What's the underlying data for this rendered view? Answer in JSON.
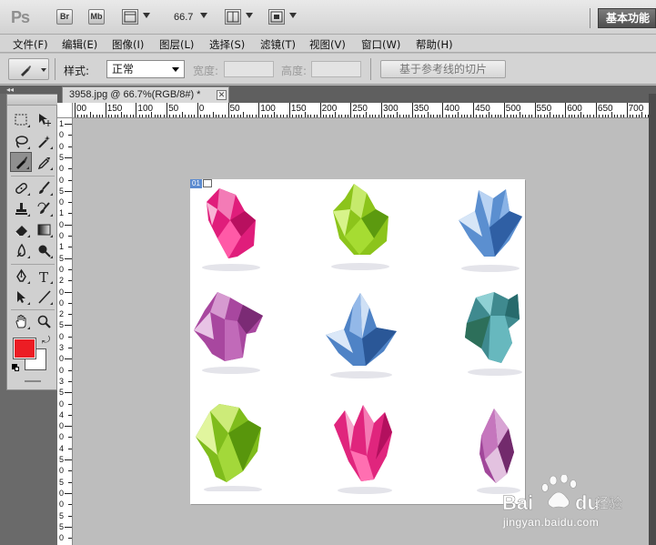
{
  "app": {
    "logo": "Ps",
    "bridge_label": "Br",
    "minibridge_label": "Mb",
    "zoom": "66.7",
    "workspace_label": "基本功能"
  },
  "menu": {
    "items": [
      "文件(F)",
      "编辑(E)",
      "图像(I)",
      "图层(L)",
      "选择(S)",
      "滤镜(T)",
      "视图(V)",
      "窗口(W)",
      "帮助(H)"
    ]
  },
  "options": {
    "style_label": "样式:",
    "style_value": "正常",
    "width_label": "宽度:",
    "height_label": "高度:",
    "slice_button": "基于参考线的切片"
  },
  "document": {
    "tab_title": "3958.jpg @ 66.7%(RGB/8#) *",
    "close_symbol": "✕",
    "slice_number": "01"
  },
  "rulers": {
    "horizontal": [
      "00",
      "150",
      "100",
      "50",
      "0",
      "50",
      "100",
      "150",
      "200",
      "250",
      "300",
      "350",
      "400",
      "450",
      "500",
      "550",
      "600",
      "650",
      "700"
    ],
    "vertical": [
      "1",
      "0",
      "0",
      "5",
      "0",
      "0",
      "5",
      "0",
      "1",
      "0",
      "0",
      "1",
      "5",
      "0",
      "2",
      "0",
      "0",
      "2",
      "5",
      "0",
      "3",
      "0",
      "0",
      "3",
      "5",
      "0",
      "4",
      "0",
      "0",
      "4",
      "5",
      "0",
      "5",
      "0",
      "0",
      "5",
      "5",
      "0"
    ]
  },
  "colors": {
    "foreground": "#ec1d24",
    "background": "#ffffff",
    "canvas_gray": "#bdbdbd"
  },
  "tools": [
    "marquee-icon",
    "move-icon",
    "lasso-icon",
    "magic-wand-icon",
    "slice-icon",
    "eyedropper-icon",
    "healing-brush-icon",
    "brush-icon",
    "clone-stamp-icon",
    "history-brush-icon",
    "eraser-icon",
    "gradient-icon",
    "blur-icon",
    "dodge-icon",
    "pen-icon",
    "type-icon",
    "path-select-icon",
    "line-icon",
    "hand-icon",
    "zoom-icon"
  ],
  "watermark": {
    "brand": "Bai",
    "brand2": "du",
    "suffix": "经验",
    "url": "jingyan.baidu.com"
  }
}
